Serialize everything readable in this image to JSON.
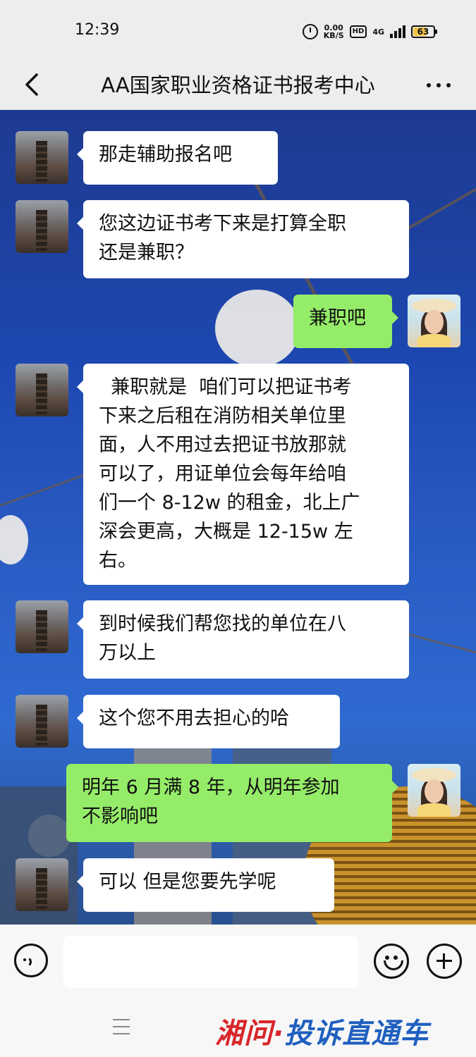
{
  "status_bar": {
    "time": "12:39",
    "net_speed_value": "0.00",
    "net_speed_unit": "KB/S",
    "hd_label": "HD",
    "signal_label": "4G",
    "battery": "63"
  },
  "nav": {
    "title": "AA国家职业资格证书报考中心"
  },
  "messages": [
    {
      "side": "left",
      "text": "那走辅助报名吧"
    },
    {
      "side": "left",
      "text": "您这边证书考下来是打算全职\n还是兼职？"
    },
    {
      "side": "right",
      "text": "兼职吧"
    },
    {
      "side": "left",
      "text": "  兼职就是  咱们可以把证书考\n下来之后租在消防相关单位里\n面，人不用过去把证书放那就\n可以了，用证单位会每年给咱\n们一个 8-12w 的租金，北上广\n深会更高，大概是 12-15w 左\n右。"
    },
    {
      "side": "left",
      "text": "到时候我们帮您找的单位在八\n万以上"
    },
    {
      "side": "left",
      "text": "这个您不用去担心的哈"
    },
    {
      "side": "right",
      "text": "明年 6 月满 8 年，从明年参加\n不影响吧"
    },
    {
      "side": "left",
      "text": "可以 但是您要先学呢"
    }
  ],
  "input": {
    "value": ""
  },
  "watermark": {
    "part1": "湘问·",
    "part2": "投诉直通车"
  },
  "colors": {
    "self_bubble": "#95ec69",
    "other_bubble": "#ffffff",
    "chrome": "#ededed"
  }
}
